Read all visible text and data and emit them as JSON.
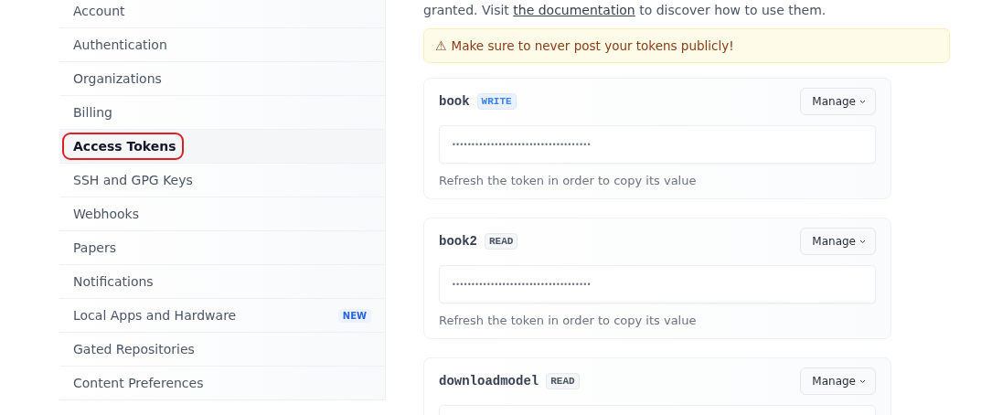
{
  "sidebar": {
    "items": [
      {
        "label": "Account",
        "selected": false,
        "annotated": false
      },
      {
        "label": "Authentication",
        "selected": false,
        "annotated": false
      },
      {
        "label": "Organizations",
        "selected": false,
        "annotated": false
      },
      {
        "label": "Billing",
        "selected": false,
        "annotated": false
      },
      {
        "label": "Access Tokens",
        "selected": true,
        "annotated": true
      },
      {
        "label": "SSH and GPG Keys",
        "selected": false,
        "annotated": false
      },
      {
        "label": "Webhooks",
        "selected": false,
        "annotated": false
      },
      {
        "label": "Papers",
        "selected": false,
        "annotated": false
      },
      {
        "label": "Notifications",
        "selected": false,
        "annotated": false
      },
      {
        "label": "Local Apps and Hardware",
        "selected": false,
        "annotated": false,
        "badge": "NEW"
      },
      {
        "label": "Gated Repositories",
        "selected": false,
        "annotated": false
      },
      {
        "label": "Content Preferences",
        "selected": false,
        "annotated": false
      }
    ]
  },
  "intro": {
    "before": "granted. Visit ",
    "link": "the documentation",
    "after": " to discover how to use them."
  },
  "warning": {
    "icon": "⚠",
    "text": "Make sure to never post your tokens publicly!"
  },
  "tokens": [
    {
      "name": "book",
      "badge": {
        "label": "WRITE",
        "kind": "write"
      },
      "button": "Manage",
      "value": "••••••••••••••••••••••••••••••••••••",
      "hint": "Refresh the token in order to copy its value"
    },
    {
      "name": "book2",
      "badge": {
        "label": "READ",
        "kind": "read"
      },
      "button": "Manage",
      "value": "••••••••••••••••••••••••••••••••••••",
      "hint": "Refresh the token in order to copy its value"
    },
    {
      "name": "downloadmodel",
      "badge": {
        "label": "READ",
        "kind": "read"
      },
      "button": "Manage"
    }
  ]
}
